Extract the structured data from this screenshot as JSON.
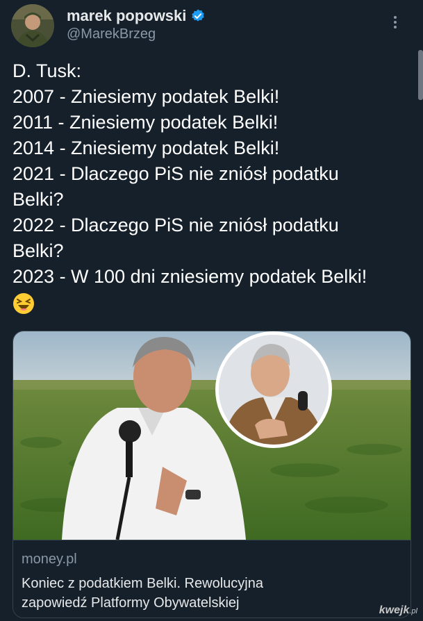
{
  "author": {
    "display_name": "marek popowski",
    "handle": "@MarekBrzeg",
    "verified": true
  },
  "tweet": {
    "lines": [
      "D. Tusk:",
      "2007 - Zniesiemy podatek Belki!",
      "2011 - Zniesiemy podatek Belki!",
      "2014 - Zniesiemy podatek Belki!",
      "2021 - Dlaczego PiS nie zniósł podatku",
      "Belki?",
      "2022 - Dlaczego PiS nie zniósł podatku",
      "Belki?",
      "2023 - W 100 dni zniesiemy podatek Belki!"
    ],
    "emoji": "laughing-face"
  },
  "link_card": {
    "domain": "money.pl",
    "title_lines": [
      "Koniec z podatkiem Belki. Rewolucyjna",
      "zapowiedź Platformy Obywatelskiej"
    ]
  },
  "watermark": {
    "text": "kwejk",
    "suffix": ".pl"
  },
  "colors": {
    "background": "#15202b",
    "verified": "#1d9bf0",
    "secondary_text": "#8b98a5",
    "primary_text": "#e7e9ea"
  }
}
